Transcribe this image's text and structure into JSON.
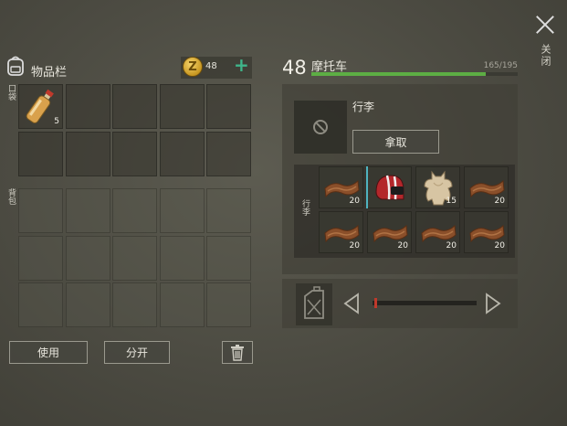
{
  "close_label": "关闭",
  "inventory": {
    "title": "物品栏",
    "pocket_label": "口袋",
    "backpack_label": "背包",
    "coins": "48",
    "coin_symbol": "Z",
    "pocket_slots": [
      {
        "item": "water-bottle-icon",
        "qty": "5"
      },
      {
        "item": "",
        "qty": ""
      },
      {
        "item": "",
        "qty": ""
      },
      {
        "item": "",
        "qty": ""
      },
      {
        "item": "",
        "qty": ""
      },
      {
        "item": "",
        "qty": ""
      },
      {
        "item": "",
        "qty": ""
      },
      {
        "item": "",
        "qty": ""
      },
      {
        "item": "",
        "qty": ""
      },
      {
        "item": "",
        "qty": ""
      }
    ],
    "backpack_rows": 3,
    "backpack_cols": 5,
    "use_button": "使用",
    "split_button": "分开"
  },
  "vehicle": {
    "level": "48",
    "name": "摩托车",
    "durability": "165/195",
    "durability_fraction": 0.846,
    "durability_color": "#5dae44",
    "cargo_title": "行李",
    "take_button": "拿取",
    "cargo_side_label": "行李",
    "cargo_slots": [
      {
        "item": "leather-icon",
        "qty": "20"
      },
      {
        "item": "motorcycle-helmet-icon",
        "qty": ""
      },
      {
        "item": "animal-hide-icon",
        "qty": "15"
      },
      {
        "item": "leather-icon",
        "qty": "20"
      },
      {
        "item": "leather-icon",
        "qty": "20"
      },
      {
        "item": "leather-icon",
        "qty": "20"
      },
      {
        "item": "leather-icon",
        "qty": "20"
      },
      {
        "item": "leather-icon",
        "qty": "20"
      }
    ],
    "fuel_level_fraction": 0.02
  }
}
